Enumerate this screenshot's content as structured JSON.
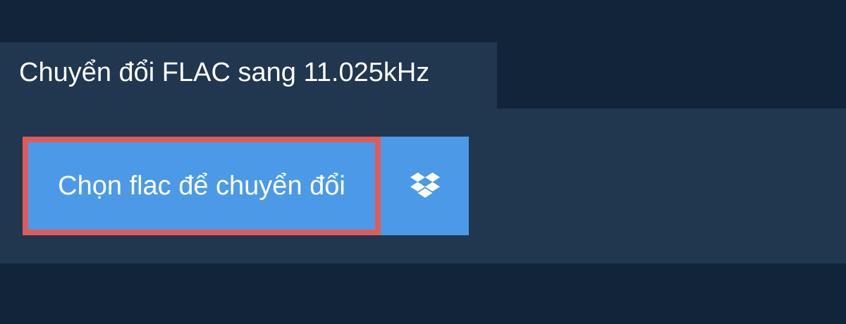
{
  "header": {
    "title": "Chuyển đổi FLAC sang 11.025kHz"
  },
  "actions": {
    "choose_label": "Chọn flac để chuyển đổi",
    "dropbox_icon": "dropbox-icon"
  },
  "colors": {
    "background": "#11243a",
    "panel": "#21364f",
    "button": "#4c9ae7",
    "button_border_highlight": "#de5b5b",
    "text": "#ffffff"
  }
}
